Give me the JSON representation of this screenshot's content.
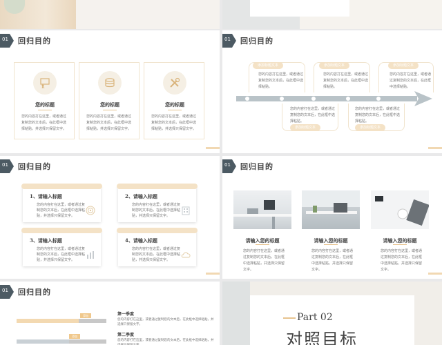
{
  "slide_header": {
    "num": "01",
    "title": "回归目的"
  },
  "slide2": {
    "cards": [
      {
        "icon": "presenter-icon",
        "title": "您的标题",
        "body": "您的内容打在这里，或者通过复制您的文本后，在此框中选择粘贴，并选择只保留文字。"
      },
      {
        "icon": "coins-icon",
        "title": "您的标题",
        "body": "您的内容打在这里，或者通过复制您的文本后，在此框中选择粘贴，并选择只保留文字。"
      },
      {
        "icon": "tools-icon",
        "title": "您的标题",
        "body": "您的内容打在这里，或者通过复制您的文本后，在此框中选择粘贴，并选择只保留文字。"
      }
    ]
  },
  "slide3": {
    "top_items": [
      {
        "pill": "添加标题文本",
        "body": "您的内容打在这里，或者通过复制您的文本后，在此框中选择粘贴。"
      },
      {
        "pill": "添加标题文本",
        "body": "您的内容打在这里，或者通过复制您的文本后，在此框中选择粘贴。"
      },
      {
        "pill": "添加标题文本",
        "body": "您的内容打在这里，或者通过复制您的文本后，在此框中选择粘贴。"
      }
    ],
    "bottom_items": [
      {
        "pill": "添加标题文本",
        "body": "您的内容打在这里，或者通过复制您的文本后，在此框中选择粘贴。"
      },
      {
        "pill": "添加标题文本",
        "body": "您的内容打在这里，或者通过复制您的文本后，在此框中选择粘贴。"
      }
    ]
  },
  "slide4": {
    "notes": [
      {
        "title": "1、请输入标题",
        "body": "您的内容打在这里，或者通过复制您的文本后，在此框中选择粘贴，并选择只保留文字。",
        "icon": "target-icon"
      },
      {
        "title": "2、请输入标题",
        "body": "您的内容打在这里，或者通过复制您的文本后，在此框中选择粘贴，并选择只保留文字。",
        "icon": "building-icon"
      },
      {
        "title": "3、请输入标题",
        "body": "您的内容打在这里，或者通过复制您的文本后，在此框中选择粘贴，并选择只保留文字。",
        "icon": "bar-chart-icon"
      },
      {
        "title": "4、请输入标题",
        "body": "您的内容打在这里，或者通过复制您的文本后，在此框中选择粘贴，并选择只保留文字。",
        "icon": "cloud-icon"
      }
    ]
  },
  "slide5": {
    "items": [
      {
        "title": "请输入您的标题",
        "body": "您的内容打在这里，或者通过复制您的文本后，在此框中选择粘贴，并选择只保留文字。"
      },
      {
        "title": "请输入您的标题",
        "body": "您的内容打在这里，或者通过复制您的文本后，在此框中选择粘贴，并选择只保留文字。"
      },
      {
        "title": "请输入您的标题",
        "body": "您的内容打在这里，或者通过复制您的文本后，在此框中选择粘贴，并选择只保留文字。"
      }
    ]
  },
  "slide6": {
    "bar_labels": [
      "添加",
      "添加"
    ],
    "quarters": [
      {
        "title": "第一季度",
        "body": "您的内容打在这里，或者通过复制您的文本后，在此框中选择粘贴，并选择只保留文字。"
      },
      {
        "title": "第二季度",
        "body": "您的内容打在这里，或者通过复制您的文本后，在此框中选择粘贴，并选择只保留文字。"
      }
    ]
  },
  "slide7": {
    "part": "Part 02",
    "title": "对照目标"
  },
  "colors": {
    "accent": "#e7c38e",
    "pill": "#f4e2c6",
    "dark_tag": "#4c5a63",
    "arrow": "#b9c3c8"
  }
}
